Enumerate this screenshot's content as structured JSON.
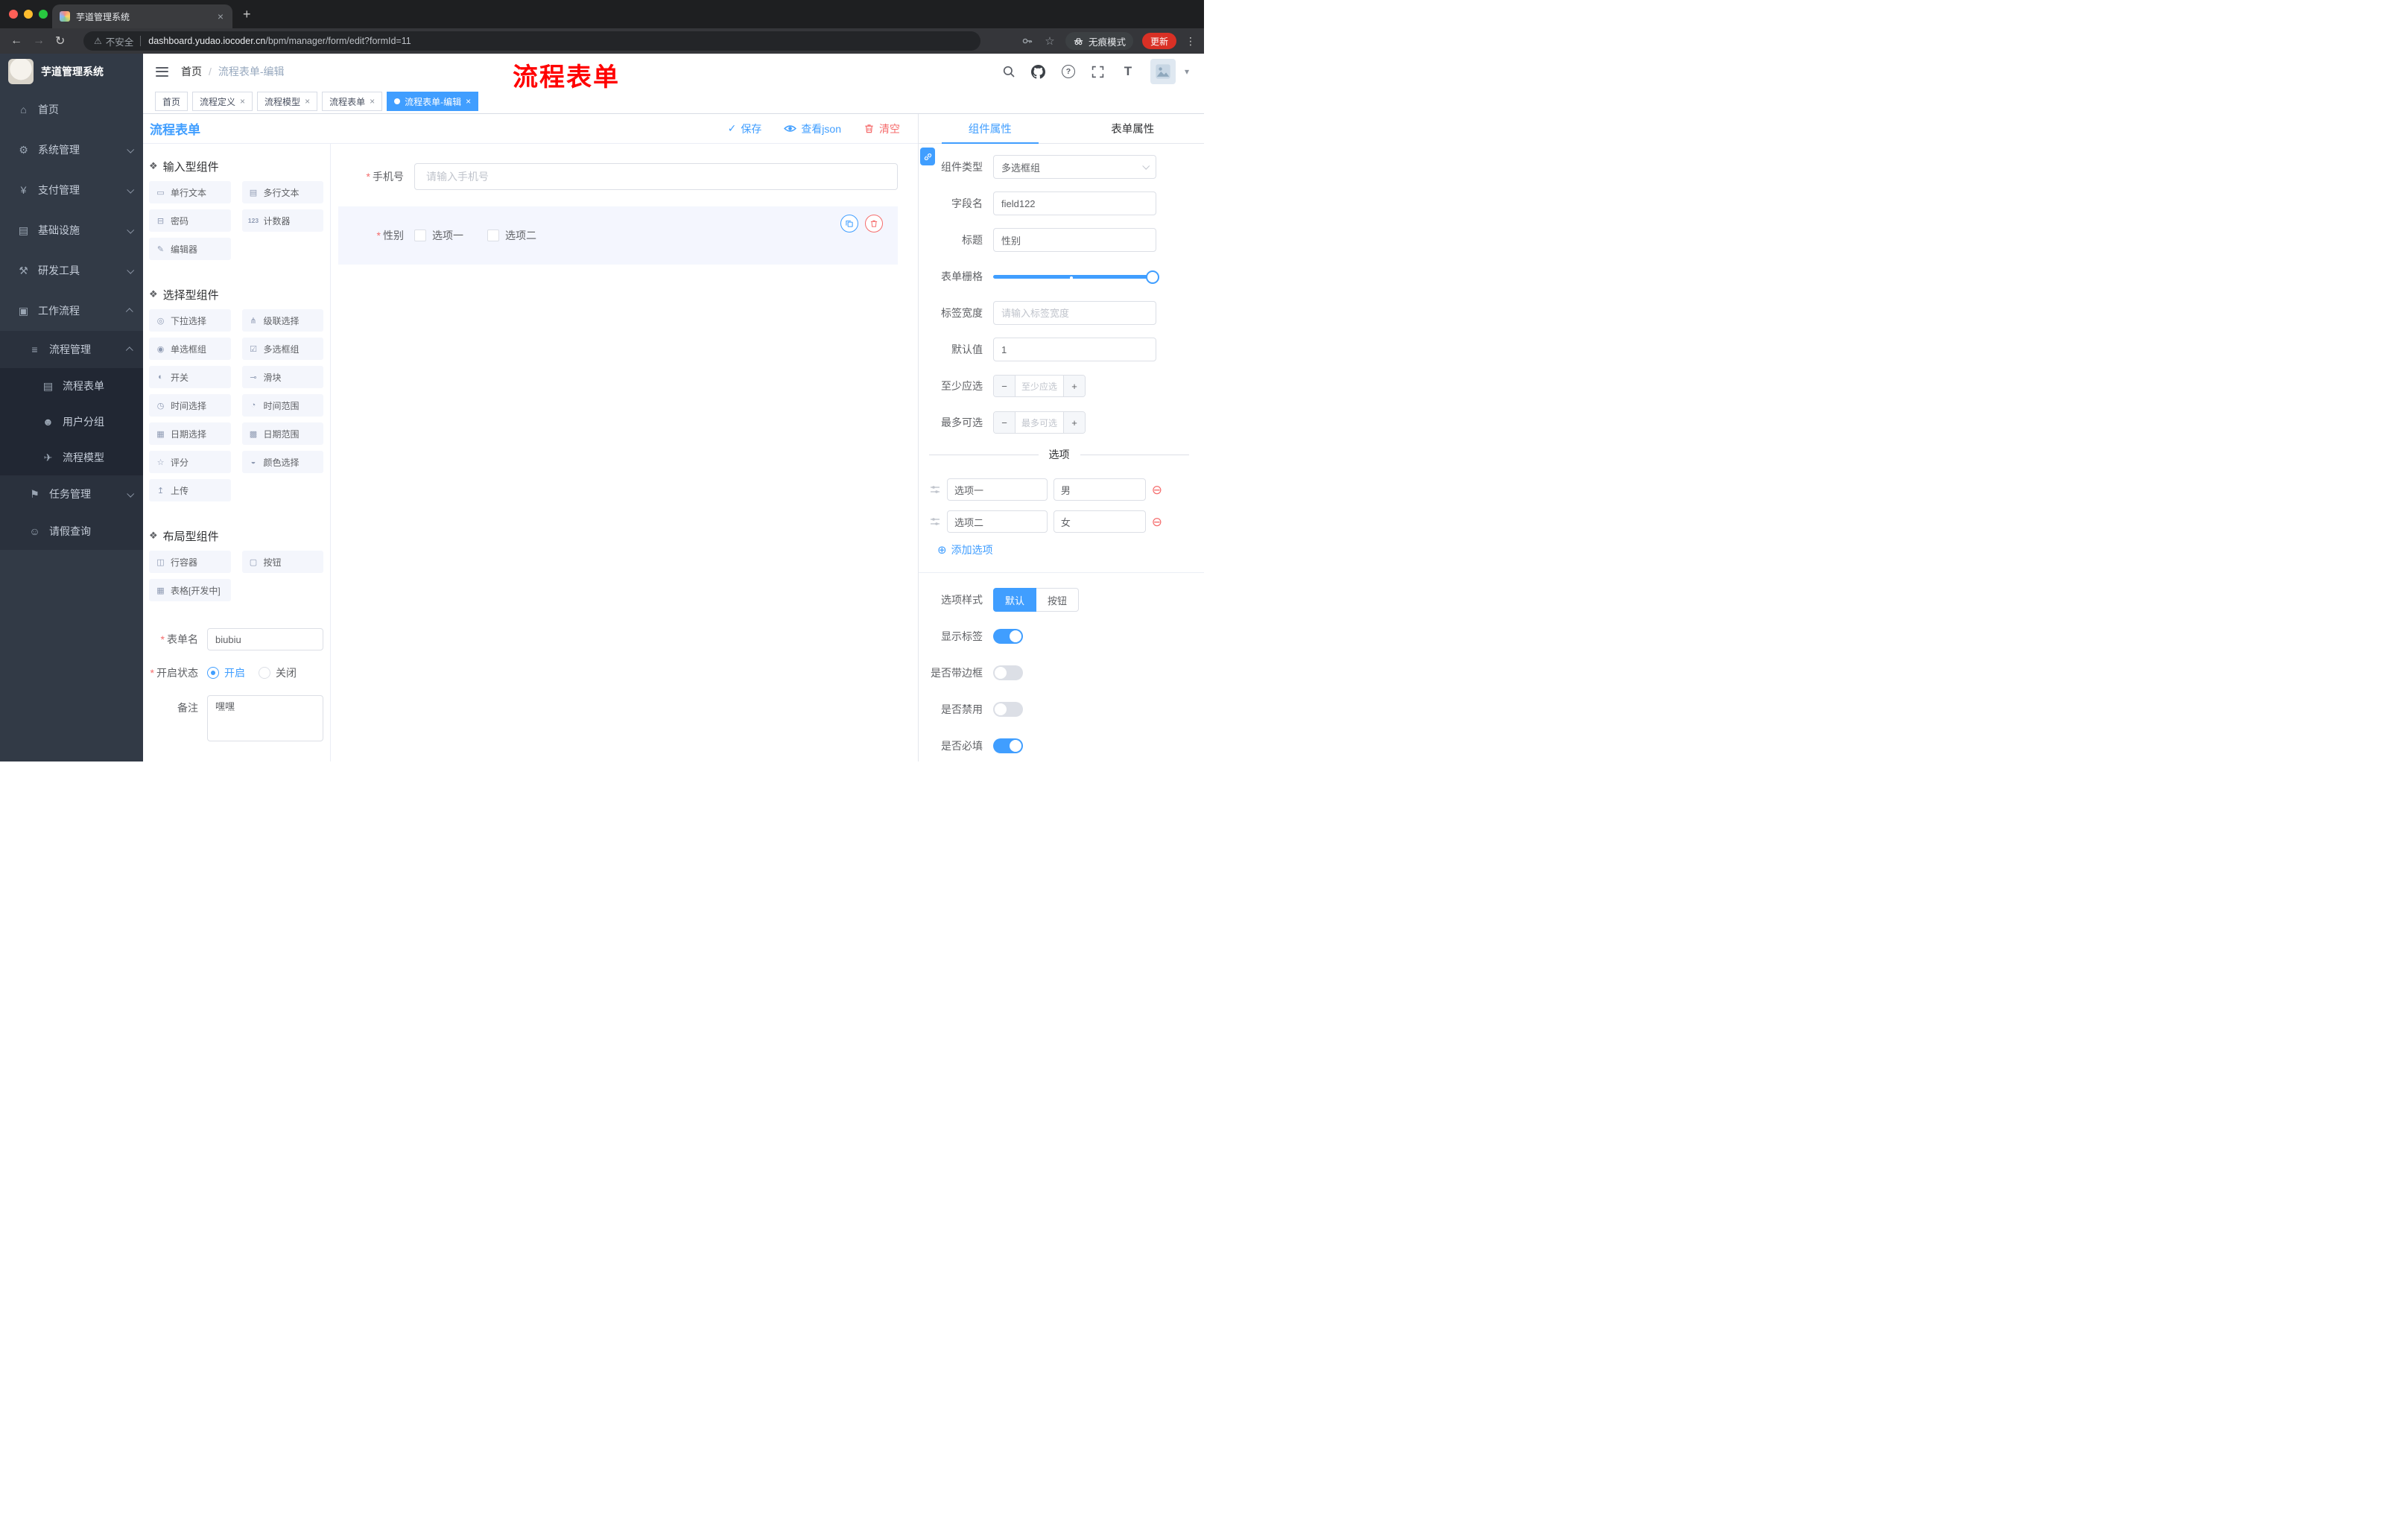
{
  "colors": {
    "accent": "#409eff",
    "danger": "#f56c6c",
    "annotation": "#ff0000",
    "sidebar_bg": "#323a46"
  },
  "icons": {
    "required": "*",
    "breadcrumb_sep": "/",
    "question": "?",
    "font_size": "T",
    "caret": "▾",
    "star": "☆",
    "warning": "⚠",
    "kebab": "⋮",
    "close": "×",
    "new_tab": "+",
    "back": "←",
    "forward": "→",
    "reload": "↻",
    "check": "✓",
    "minus": "−",
    "plus": "+",
    "remove": "⊖",
    "add": "⊕"
  },
  "browser": {
    "tab_title": "芋道管理系统",
    "security_label": "不安全",
    "url_domain": "dashboard.yudao.iocoder.cn",
    "url_path": "/bpm/manager/form/edit?formId=11",
    "incognito_label": "无痕模式",
    "update_label": "更新"
  },
  "sidebar": {
    "logo_title": "芋道管理系统",
    "items": [
      {
        "label": "首页",
        "icon": "⌂"
      },
      {
        "label": "系统管理",
        "icon": "⚙"
      },
      {
        "label": "支付管理",
        "icon": "¥"
      },
      {
        "label": "基础设施",
        "icon": "▤"
      },
      {
        "label": "研发工具",
        "icon": "⚒"
      },
      {
        "label": "工作流程",
        "icon": "▣"
      },
      {
        "label": "流程管理",
        "icon": "≡"
      },
      {
        "label": "流程表单",
        "icon": "▤"
      },
      {
        "label": "用户分组",
        "icon": "☻"
      },
      {
        "label": "流程模型",
        "icon": "✈"
      },
      {
        "label": "任务管理",
        "icon": "⚑"
      },
      {
        "label": "请假查询",
        "icon": "☺"
      }
    ]
  },
  "header": {
    "breadcrumb_home": "首页",
    "breadcrumb_current": "流程表单-编辑",
    "annotation": "流程表单"
  },
  "tags": [
    {
      "label": "首页"
    },
    {
      "label": "流程定义"
    },
    {
      "label": "流程模型"
    },
    {
      "label": "流程表单"
    },
    {
      "label": "流程表单-编辑"
    }
  ],
  "designer": {
    "title": "流程表单",
    "actions": {
      "save": "保存",
      "view_json": "查看json",
      "clear": "清空"
    },
    "groups": [
      {
        "title": "输入型组件",
        "items": [
          {
            "label": "单行文本",
            "icon": "▭"
          },
          {
            "label": "多行文本",
            "icon": "▤"
          },
          {
            "label": "密码",
            "icon": "⊟"
          },
          {
            "label": "计数器",
            "icon": "123"
          },
          {
            "label": "编辑器",
            "icon": "✎"
          }
        ]
      },
      {
        "title": "选择型组件",
        "items": [
          {
            "label": "下拉选择",
            "icon": "◎"
          },
          {
            "label": "级联选择",
            "icon": "⋔"
          },
          {
            "label": "单选框组",
            "icon": "◉"
          },
          {
            "label": "多选框组",
            "icon": "☑"
          },
          {
            "label": "开关",
            "icon": "◐"
          },
          {
            "label": "滑块",
            "icon": "⊸"
          },
          {
            "label": "时间选择",
            "icon": "◷"
          },
          {
            "label": "时间范围",
            "icon": "◔"
          },
          {
            "label": "日期选择",
            "icon": "▦"
          },
          {
            "label": "日期范围",
            "icon": "▩"
          },
          {
            "label": "评分",
            "icon": "☆"
          },
          {
            "label": "颜色选择",
            "icon": "◒"
          },
          {
            "label": "上传",
            "icon": "↥"
          }
        ]
      },
      {
        "title": "布局型组件",
        "items": [
          {
            "label": "行容器",
            "icon": "◫"
          },
          {
            "label": "按钮",
            "icon": "▢"
          },
          {
            "label": "表格[开发中]",
            "icon": "▦"
          }
        ]
      }
    ],
    "meta": {
      "form_name": {
        "label": "表单名",
        "value": "biubiu"
      },
      "status": {
        "label": "开启状态",
        "on": "开启",
        "off": "关闭"
      },
      "remark": {
        "label": "备注",
        "value": "嘿嘿"
      }
    },
    "canvas": {
      "phone": {
        "label": "手机号",
        "placeholder": "请输入手机号"
      },
      "gender": {
        "label": "性别",
        "options": [
          "选项一",
          "选项二"
        ]
      }
    }
  },
  "props": {
    "tabs": {
      "component": "组件属性",
      "form": "表单属性"
    },
    "type": {
      "label": "组件类型",
      "value": "多选框组"
    },
    "field": {
      "label": "字段名",
      "value": "field122"
    },
    "title": {
      "label": "标题",
      "value": "性别"
    },
    "grid": {
      "label": "表单栅格"
    },
    "label_width": {
      "label": "标签宽度",
      "placeholder": "请输入标签宽度"
    },
    "default": {
      "label": "默认值",
      "value": "1"
    },
    "min": {
      "label": "至少应选",
      "placeholder": "至少应选"
    },
    "max": {
      "label": "最多可选",
      "placeholder": "最多可选"
    },
    "options_title": "选项",
    "options": [
      {
        "label": "选项一",
        "value": "男"
      },
      {
        "label": "选项二",
        "value": "女"
      }
    ],
    "add_option": "添加选项",
    "style": {
      "label": "选项样式",
      "default": "默认",
      "button": "按钮"
    },
    "show_label": {
      "label": "显示标签"
    },
    "border": {
      "label": "是否带边框"
    },
    "disabled": {
      "label": "是否禁用"
    },
    "required": {
      "label": "是否必填"
    }
  }
}
